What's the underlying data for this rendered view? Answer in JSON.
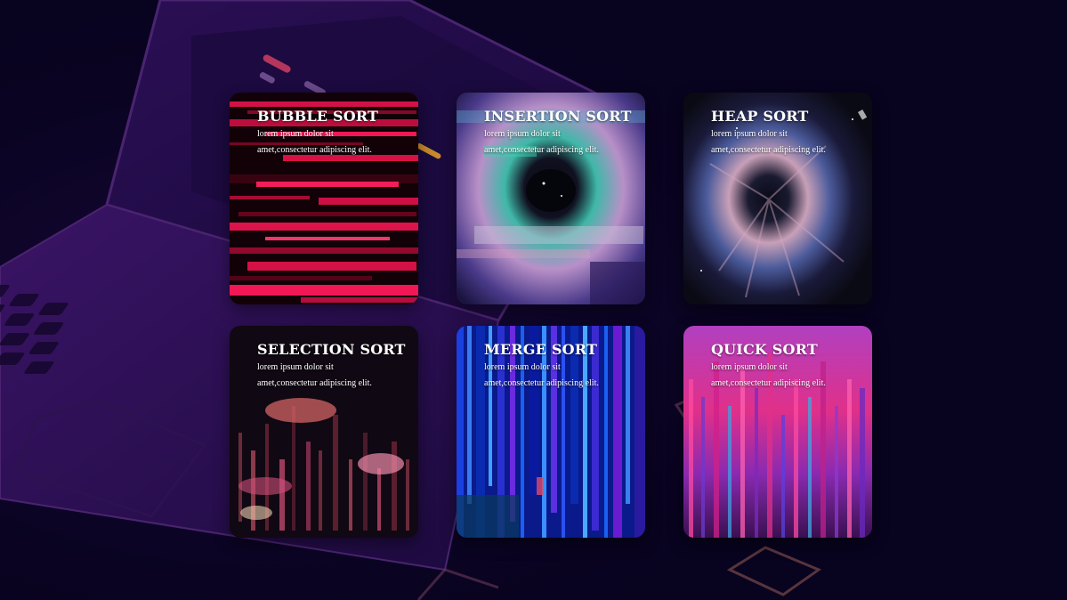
{
  "colors": {
    "background": "#08031f",
    "laptop": "#2a0f52",
    "outline": "#6a3a6a"
  },
  "cards": [
    {
      "title": "BUBBLE SORT",
      "line1": "lorem ipsum dolor sit",
      "line2": "amet,consectetur adipiscing elit."
    },
    {
      "title": "INSERTION SORT",
      "line1": "lorem ipsum dolor sit",
      "line2": "amet,consectetur adipiscing elit."
    },
    {
      "title": "HEAP SORT",
      "line1": "lorem ipsum dolor sit",
      "line2": "amet,consectetur adipiscing elit."
    },
    {
      "title": "SELECTION SORT",
      "line1": "lorem ipsum dolor sit",
      "line2": "amet,consectetur adipiscing elit."
    },
    {
      "title": "MERGE SORT",
      "line1": "lorem ipsum dolor sit",
      "line2": "amet,consectetur adipiscing elit."
    },
    {
      "title": "QUICK SORT",
      "line1": "lorem ipsum dolor sit",
      "line2": "amet,consectetur adipiscing elit."
    }
  ]
}
